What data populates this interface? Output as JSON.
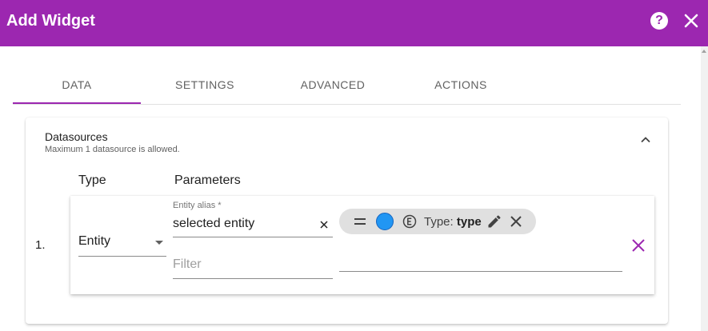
{
  "dialog": {
    "title": "Add Widget",
    "help_icon": "help-circle-icon",
    "close_icon": "close-icon"
  },
  "tabs": [
    {
      "label": "DATA",
      "active": true
    },
    {
      "label": "SETTINGS",
      "active": false
    },
    {
      "label": "ADVANCED",
      "active": false
    },
    {
      "label": "ACTIONS",
      "active": false
    }
  ],
  "datasources": {
    "title": "Datasources",
    "subtitle": "Maximum 1 datasource is allowed.",
    "collapse_icon": "chevron-up-icon",
    "columns": {
      "type": "Type",
      "parameters": "Parameters"
    },
    "rows": [
      {
        "index": "1.",
        "type_value": "Entity",
        "entity_alias_label": "Entity alias *",
        "entity_alias_value": "selected entity",
        "filter_placeholder": "Filter",
        "key_chip": {
          "prefix": "Type:",
          "key": "type",
          "color": "#2196f3",
          "entity_icon": "entity-e-icon"
        }
      }
    ]
  },
  "colors": {
    "accent": "#9c27b0",
    "chip_background": "#e0e0e0",
    "key_color": "#2196f3"
  }
}
